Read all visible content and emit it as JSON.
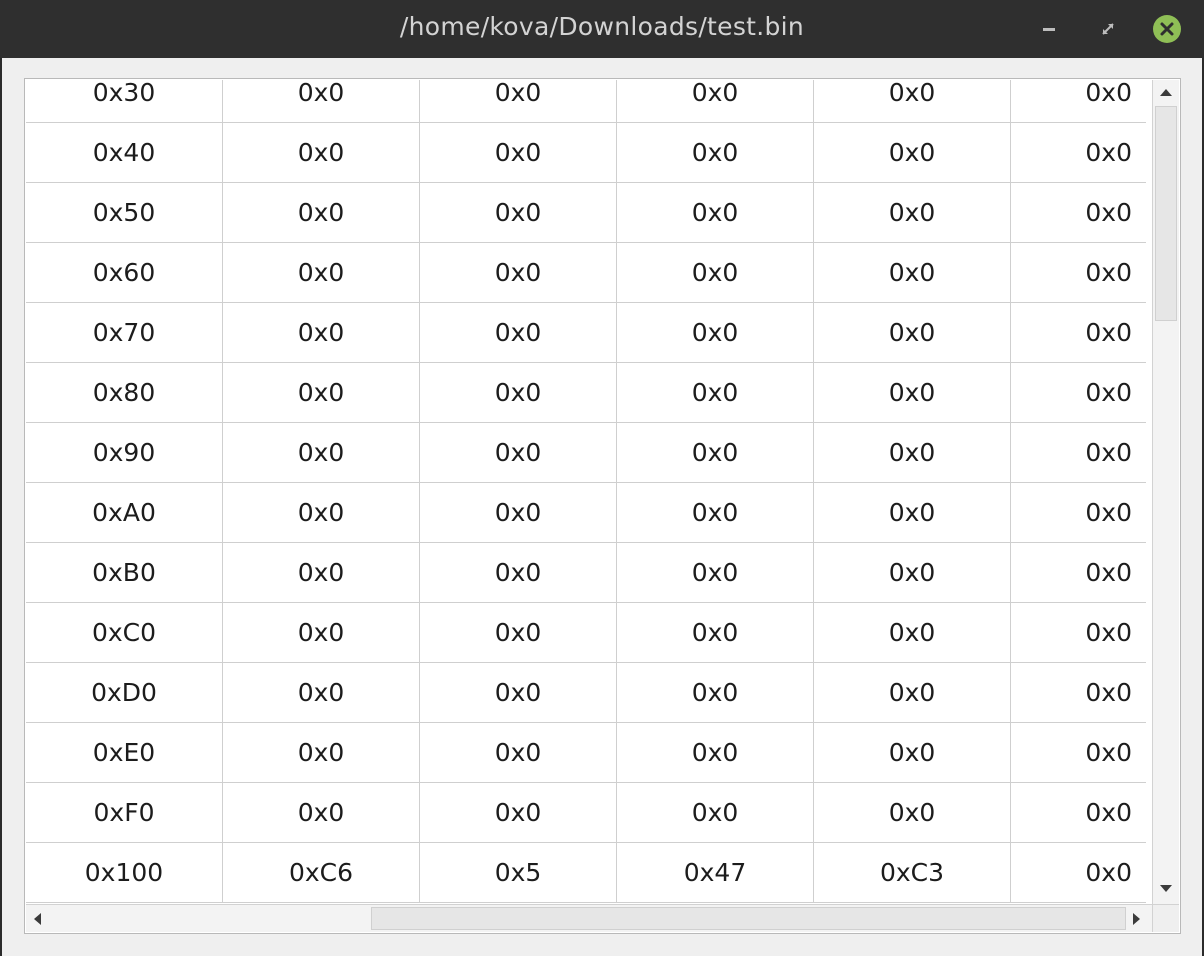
{
  "window": {
    "title": "/home/kova/Downloads/test.bin"
  },
  "table": {
    "rows": [
      [
        "0x30",
        "0x0",
        "0x0",
        "0x0",
        "0x0",
        "0x0"
      ],
      [
        "0x40",
        "0x0",
        "0x0",
        "0x0",
        "0x0",
        "0x0"
      ],
      [
        "0x50",
        "0x0",
        "0x0",
        "0x0",
        "0x0",
        "0x0"
      ],
      [
        "0x60",
        "0x0",
        "0x0",
        "0x0",
        "0x0",
        "0x0"
      ],
      [
        "0x70",
        "0x0",
        "0x0",
        "0x0",
        "0x0",
        "0x0"
      ],
      [
        "0x80",
        "0x0",
        "0x0",
        "0x0",
        "0x0",
        "0x0"
      ],
      [
        "0x90",
        "0x0",
        "0x0",
        "0x0",
        "0x0",
        "0x0"
      ],
      [
        "0xA0",
        "0x0",
        "0x0",
        "0x0",
        "0x0",
        "0x0"
      ],
      [
        "0xB0",
        "0x0",
        "0x0",
        "0x0",
        "0x0",
        "0x0"
      ],
      [
        "0xC0",
        "0x0",
        "0x0",
        "0x0",
        "0x0",
        "0x0"
      ],
      [
        "0xD0",
        "0x0",
        "0x0",
        "0x0",
        "0x0",
        "0x0"
      ],
      [
        "0xE0",
        "0x0",
        "0x0",
        "0x0",
        "0x0",
        "0x0"
      ],
      [
        "0xF0",
        "0x0",
        "0x0",
        "0x0",
        "0x0",
        "0x0"
      ],
      [
        "0x100",
        "0xC6",
        "0x5",
        "0x47",
        "0xC3",
        "0x0"
      ]
    ]
  },
  "icons": {
    "minimize": "minimize-icon",
    "maximize": "maximize-icon",
    "close": "close-icon"
  },
  "colors": {
    "titlebar": "#2f2f2f",
    "close_button": "#8fbf56"
  }
}
